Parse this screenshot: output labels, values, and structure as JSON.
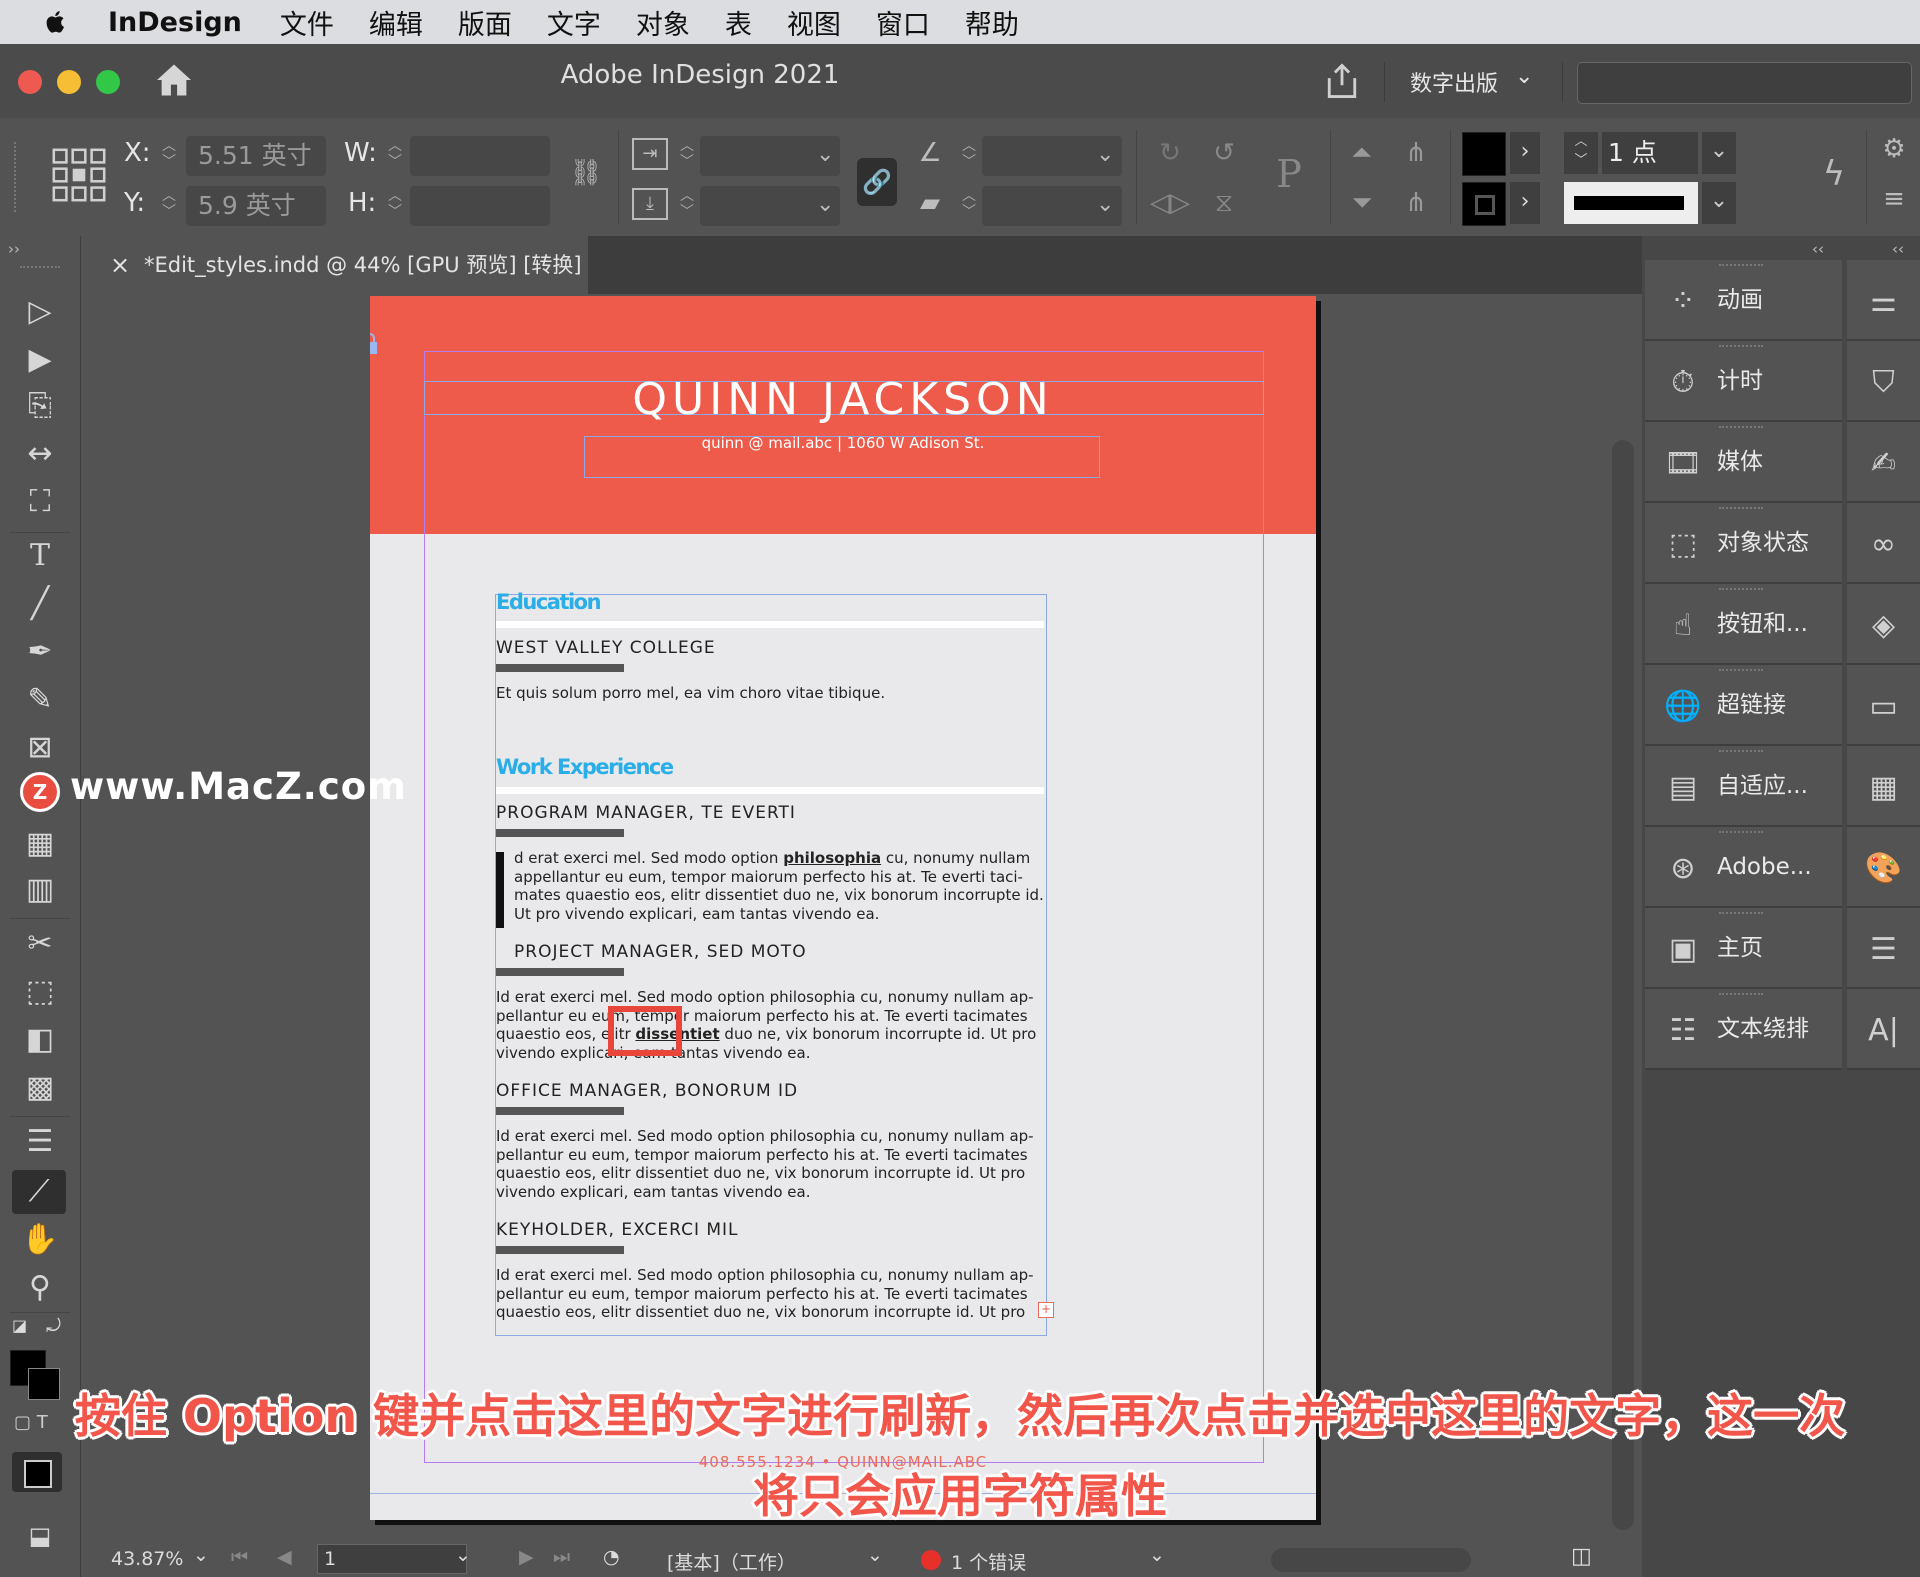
{
  "menubar": {
    "app": "InDesign",
    "items": [
      "文件",
      "编辑",
      "版面",
      "文字",
      "对象",
      "表",
      "视图",
      "窗口",
      "帮助"
    ]
  },
  "window": {
    "title": "Adobe InDesign 2021",
    "workspace": "数字出版"
  },
  "control": {
    "x_label": "X:",
    "x_value": "5.51 英寸",
    "y_label": "Y:",
    "y_value": "5.9 英寸",
    "w_label": "W:",
    "h_label": "H:",
    "stroke_weight": "1 点"
  },
  "doc_tab": {
    "close": "×",
    "title": "*Edit_styles.indd @ 44% [GPU 预览] [转换]"
  },
  "document": {
    "name": "QUINN JACKSON",
    "contact": "quinn @ mail.abc  |  1060 W Adison St.",
    "sections": {
      "education": "Education",
      "work": "Work Experience"
    },
    "jobs": [
      "WEST VALLEY COLLEGE",
      "PROGRAM MANAGER, TE EVERTI",
      "PROJECT MANAGER, SED MOTO",
      "OFFICE MANAGER, BONORUM ID",
      "KEYHOLDER, EXCERCI MIL"
    ],
    "edu_text": "Et quis solum porro mel, ea vim choro vitae tibique.",
    "p1_a": "d erat exerci mel. Sed modo option ",
    "p1_bold": "philosophia",
    "p1_b": " cu, nonumy nullam appellantur eu eum, tempor maiorum perfecto his at. Te everti taci-mates quaestio eos, elitr dissentiet duo ne, vix bonorum incorrupte id. Ut pro vivendo explicari, eam tantas vivendo ea.",
    "p2_a": "Id erat exerci mel. Sed modo option philosophia cu, nonumy nullam ap-pellantur eu eum, tempor maiorum perfecto his at. Te everti tacimates quaestio eos, elitr ",
    "p2_bold": "dissentiet",
    "p2_b": " duo ne, vix bonorum incorrupte id. Ut pro vivendo explicari, eam tantas vivendo ea.",
    "p3": "Id erat exerci mel. Sed modo option philosophia cu, nonumy nullam ap-pellantur eu eum, tempor maiorum perfecto his at. Te everti tacimates quaestio eos, elitr dissentiet duo ne, vix bonorum incorrupte id. Ut pro vivendo explicari, eam tantas vivendo ea.",
    "p4": "Id erat exerci mel. Sed modo option philosophia cu, nonumy nullam ap-pellantur eu eum, tempor maiorum perfecto his at. Te everti tacimates quaestio eos, elitr dissentiet duo ne, vix bonorum incorrupte id. Ut pro",
    "footer": "408.555.1234  •  QUINN@MAIL.ABC"
  },
  "panels": [
    "动画",
    "计时",
    "媒体",
    "对象状态",
    "按钮和...",
    "超链接",
    "自适应...",
    "Adobe...",
    "主页",
    "文本绕排"
  ],
  "status": {
    "zoom": "43.87%",
    "page": "1",
    "style": "[基本]（工作）",
    "errors": "1 个错误"
  },
  "caption": {
    "line1": "按住 Option 键并点击这里的文字进行刷新，然后再次点击并选中这里的文字，这一次",
    "line2": "将只会应用字符属性"
  },
  "watermark": "www.MacZ.com",
  "colors": {
    "header_red": "#ee5b4b",
    "section_blue": "#29aee8",
    "highlight_box": "#e8463a"
  }
}
